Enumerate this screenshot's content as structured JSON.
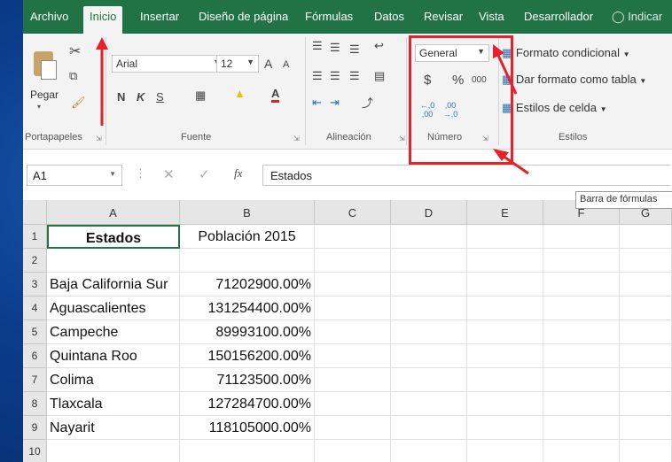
{
  "tabs": [
    "Archivo",
    "Inicio",
    "Insertar",
    "Diseño de página",
    "Fórmulas",
    "Datos",
    "Revisar",
    "Vista",
    "Desarrollador",
    "Indicar"
  ],
  "ribbon": {
    "clipboard": {
      "paste_label": "Pegar",
      "group_label": "Portapapeles"
    },
    "font": {
      "font_name": "Arial",
      "font_size": "12",
      "grow": "A",
      "shrink": "A",
      "bold": "N",
      "italic": "K",
      "underline": "S",
      "font_color": "A",
      "group_label": "Fuente"
    },
    "alignment": {
      "group_label": "Alineación"
    },
    "number": {
      "format": "General",
      "currency": "$",
      "percent": "%",
      "thousands": "000",
      "inc_dec": "←,0 ,00",
      "dec_dec": ",00 →,0",
      "group_label": "Número"
    },
    "styles": {
      "conditional": "Formato condicional",
      "as_table": "Dar formato como tabla",
      "cell_styles": "Estilos de celda",
      "group_label": "Estilos"
    }
  },
  "formula_bar": {
    "name_box": "A1",
    "fx": "fx",
    "content": "Estados",
    "tooltip": "Barra de fórmulas"
  },
  "sheet": {
    "columns": [
      "A",
      "B",
      "C",
      "D",
      "E",
      "F",
      "G"
    ],
    "rows": [
      {
        "n": "1",
        "a": "Estados",
        "b": "Población 2015"
      },
      {
        "n": "2",
        "a": "",
        "b": ""
      },
      {
        "n": "3",
        "a": "Baja California Sur",
        "b": "71202900.00%"
      },
      {
        "n": "4",
        "a": "Aguascalientes",
        "b": "131254400.00%"
      },
      {
        "n": "5",
        "a": "Campeche",
        "b": "89993100.00%"
      },
      {
        "n": "6",
        "a": "Quintana Roo",
        "b": "150156200.00%"
      },
      {
        "n": "7",
        "a": "Colima",
        "b": "71123500.00%"
      },
      {
        "n": "8",
        "a": "Tlaxcala",
        "b": "127284700.00%"
      },
      {
        "n": "9",
        "a": "Nayarit",
        "b": "118105000.00%"
      },
      {
        "n": "10",
        "a": "",
        "b": ""
      }
    ]
  },
  "colors": {
    "accent": "#217346",
    "highlight": "#e8202a"
  }
}
